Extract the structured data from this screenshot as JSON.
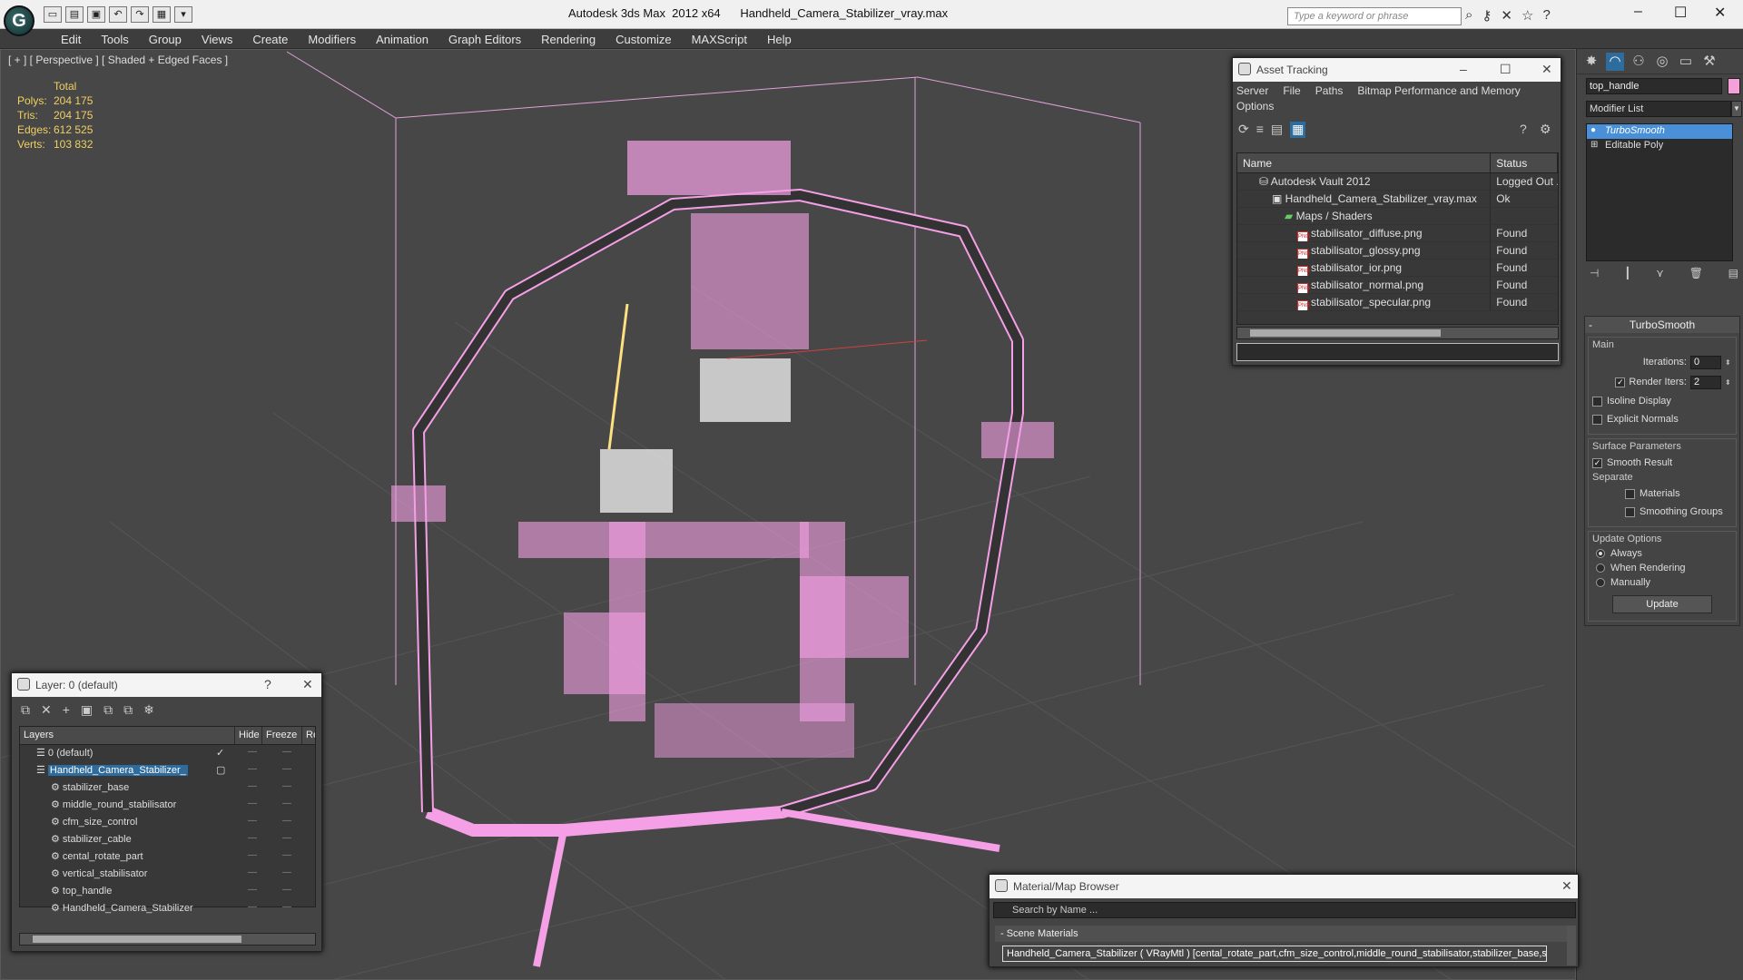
{
  "app": {
    "logo": "G",
    "title": "Autodesk 3ds Max  2012 x64      Handheld_Camera_Stabilizer_vray.max",
    "search_placeholder": "Type a keyword or phrase"
  },
  "menu": [
    "Edit",
    "Tools",
    "Group",
    "Views",
    "Create",
    "Modifiers",
    "Animation",
    "Graph Editors",
    "Rendering",
    "Customize",
    "MAXScript",
    "Help"
  ],
  "viewport": {
    "label": "[ + ] [ Perspective ] [ Shaded + Edged Faces ]",
    "stats_header": "Total",
    "stats": [
      {
        "k": "Polys:",
        "v": "204 175"
      },
      {
        "k": "Tris:",
        "v": "204 175"
      },
      {
        "k": "Edges:",
        "v": "612 525"
      },
      {
        "k": "Verts:",
        "v": "103 832"
      }
    ],
    "wire_color": "#f5a0e6"
  },
  "command_panel": {
    "object_name": "top_handle",
    "modifier_list": "Modifier List",
    "stack": [
      "TurboSmooth",
      "Editable Poly"
    ],
    "rollout": {
      "title": "TurboSmooth",
      "main_group": "Main",
      "iterations_label": "Iterations:",
      "iterations": "0",
      "render_iters_label": "Render Iters:",
      "render_iters": "2",
      "isoline": "Isoline Display",
      "explicit": "Explicit Normals",
      "surface_group": "Surface Parameters",
      "smooth_result": "Smooth Result",
      "separate": "Separate",
      "materials": "Materials",
      "smoothing_groups": "Smoothing Groups",
      "update_group": "Update Options",
      "always": "Always",
      "when_rendering": "When Rendering",
      "manually": "Manually",
      "update_btn": "Update"
    }
  },
  "asset_tracking": {
    "title": "Asset Tracking",
    "menu": [
      "Server",
      "File",
      "Paths",
      "Bitmap Performance and Memory",
      "Options"
    ],
    "columns": [
      "Name",
      "Status"
    ],
    "rows": [
      {
        "name": "Autodesk Vault 2012",
        "status": "Logged Out ..."
      },
      {
        "name": "Handheld_Camera_Stabilizer_vray.max",
        "status": "Ok"
      },
      {
        "name": "Maps / Shaders",
        "status": ""
      },
      {
        "name": "stabilisator_diffuse.png",
        "status": "Found"
      },
      {
        "name": "stabilisator_glossy.png",
        "status": "Found"
      },
      {
        "name": "stabilisator_ior.png",
        "status": "Found"
      },
      {
        "name": "stabilisator_normal.png",
        "status": "Found"
      },
      {
        "name": "stabilisator_specular.png",
        "status": "Found"
      }
    ]
  },
  "layer_dialog": {
    "title": "Layer: 0 (default)",
    "help": "?",
    "columns": [
      "Layers",
      "Hide",
      "Freeze",
      "Re"
    ],
    "rows": [
      {
        "name": "0 (default)"
      },
      {
        "name": "Handheld_Camera_Stabilizer_"
      },
      {
        "name": "stabilizer_base"
      },
      {
        "name": "middle_round_stabilisator"
      },
      {
        "name": "cfm_size_control"
      },
      {
        "name": "stabilizer_cable"
      },
      {
        "name": "cental_rotate_part"
      },
      {
        "name": "vertical_stabilisator"
      },
      {
        "name": "top_handle"
      },
      {
        "name": "Handheld_Camera_Stabilizer"
      }
    ]
  },
  "material_browser": {
    "title": "Material/Map Browser",
    "search_placeholder": "Search by Name ...",
    "section": "- Scene Materials",
    "item": "Handheld_Camera_Stabilizer ( VRayMtl ) [cental_rotate_part,cfm_size_control,middle_round_stabilisator,stabilizer_base,stabilizer_cable,top_h..."
  }
}
